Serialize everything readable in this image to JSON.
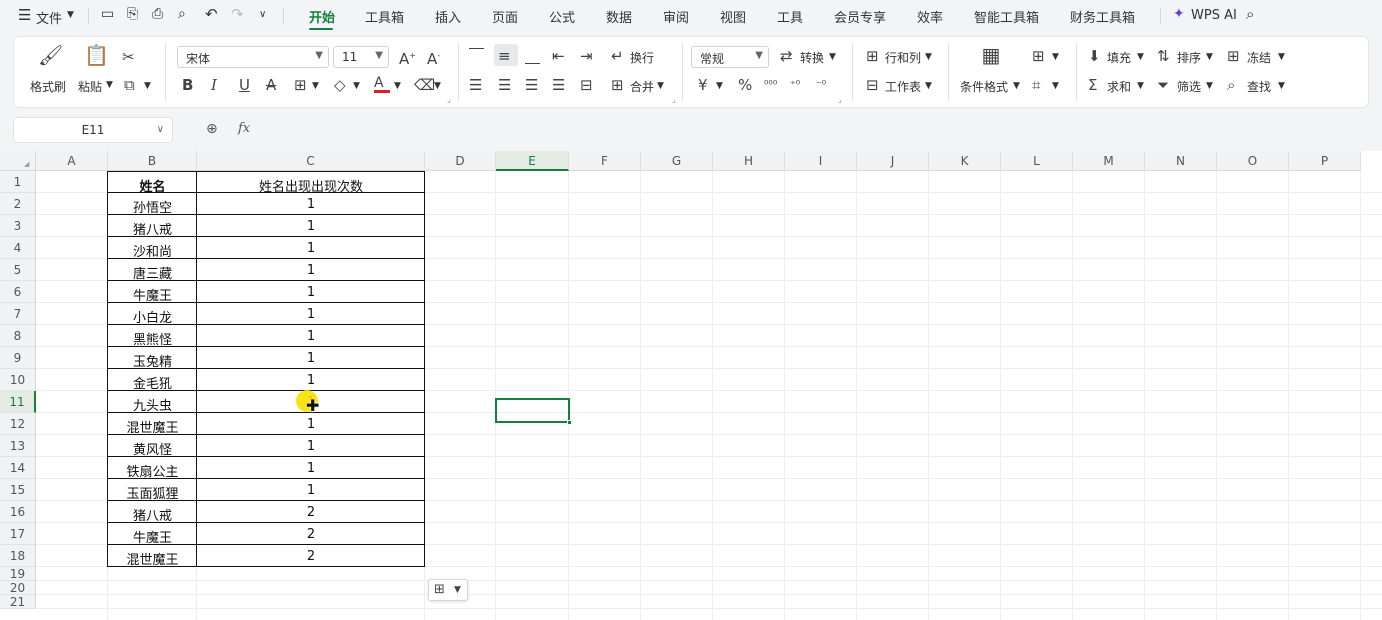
{
  "menubar": {
    "file_label": "文件",
    "tabs": [
      "开始",
      "工具箱",
      "插入",
      "页面",
      "公式",
      "数据",
      "审阅",
      "视图",
      "工具",
      "会员专享",
      "效率",
      "智能工具箱",
      "财务工具箱"
    ],
    "wps_ai_label": "WPS AI"
  },
  "ribbon": {
    "format_painter": "格式刷",
    "paste": "粘贴",
    "font_name": "宋体",
    "font_size": "11",
    "wrap": "换行",
    "merge": "合并",
    "number_format": "常规",
    "convert": "转换",
    "row_col": "行和列",
    "worksheet": "工作表",
    "conditional_format": "条件格式",
    "fill": "填充",
    "sort": "排序",
    "freeze": "冻结",
    "sum": "求和",
    "filter": "筛选",
    "find": "查找",
    "currency_symbol": "¥",
    "percent_symbol": "%"
  },
  "formula_bar": {
    "name_box": "E11",
    "fx": "fx",
    "formula": ""
  },
  "columns": [
    "A",
    "B",
    "C",
    "D",
    "E",
    "F",
    "G",
    "H",
    "I",
    "J",
    "K",
    "L",
    "M",
    "N",
    "O",
    "P"
  ],
  "rows": [
    "1",
    "2",
    "3",
    "4",
    "5",
    "6",
    "7",
    "8",
    "9",
    "10",
    "11",
    "12",
    "13",
    "14",
    "15",
    "16",
    "17",
    "18",
    "19",
    "20",
    "21"
  ],
  "selected_cell": "E11",
  "table": {
    "headers": [
      "姓名",
      "姓名出现出现次数"
    ],
    "rows": [
      [
        "孙悟空",
        "1"
      ],
      [
        "猪八戒",
        "1"
      ],
      [
        "沙和尚",
        "1"
      ],
      [
        "唐三藏",
        "1"
      ],
      [
        "牛魔王",
        "1"
      ],
      [
        "小白龙",
        "1"
      ],
      [
        "黑熊怪",
        "1"
      ],
      [
        "玉兔精",
        "1"
      ],
      [
        "金毛犼",
        "1"
      ],
      [
        "九头虫",
        "1"
      ],
      [
        "混世魔王",
        "1"
      ],
      [
        "黄风怪",
        "1"
      ],
      [
        "铁扇公主",
        "1"
      ],
      [
        "玉面狐狸",
        "1"
      ],
      [
        "猪八戒",
        "2"
      ],
      [
        "牛魔王",
        "2"
      ],
      [
        "混世魔王",
        "2"
      ]
    ]
  },
  "colors": {
    "accent": "#15803d",
    "font_color_bar": "#e02020",
    "cursor_highlight": "#f5e000"
  }
}
